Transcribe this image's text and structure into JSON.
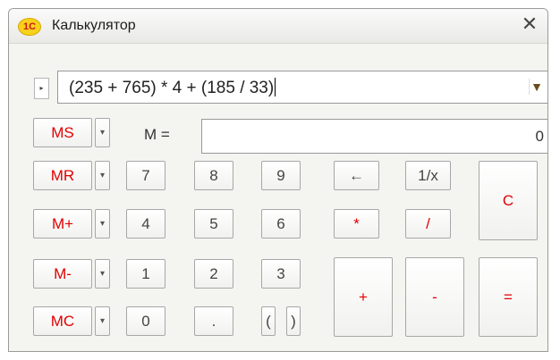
{
  "window": {
    "title": "Калькулятор",
    "logo": "1С",
    "close": "✕"
  },
  "expression": {
    "toggle": "▸",
    "text": "(235 + 765) * 4 + (185 / 33)",
    "dropdown": "▼"
  },
  "memory": {
    "ms": "MS",
    "mr": "MR",
    "mplus": "M+",
    "mminus": "M-",
    "mc": "MC",
    "arrow": "▾",
    "label": "M =",
    "value": "0"
  },
  "keys": {
    "seven": "7",
    "eight": "8",
    "nine": "9",
    "four": "4",
    "five": "5",
    "six": "6",
    "one": "1",
    "two": "2",
    "three": "3",
    "zero": "0",
    "decimal": ".",
    "open_paren": "(",
    "close_paren": ")",
    "backspace": "←",
    "reciprocal": "1/x",
    "multiply": "*",
    "divide": "/",
    "plus": "+",
    "minus": "-",
    "equals": "=",
    "clear": "C"
  },
  "colors": {
    "accent": "#e10000",
    "window_bg": "#f4f4f1"
  }
}
